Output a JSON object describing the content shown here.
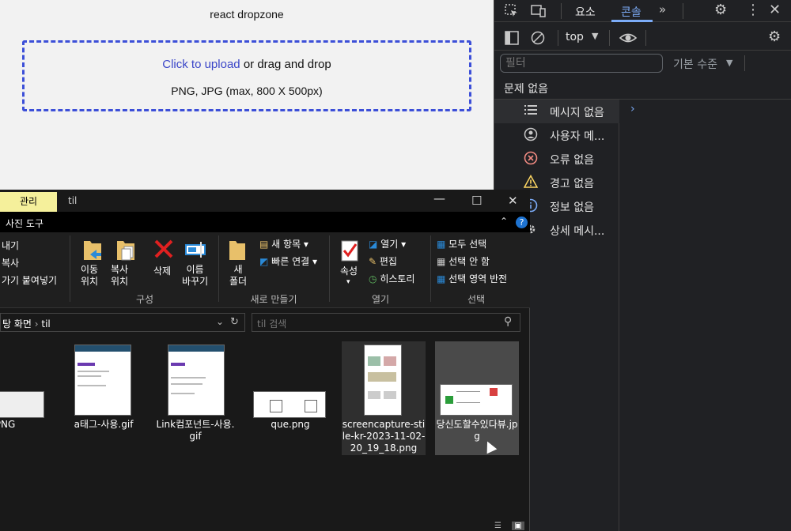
{
  "browser": {
    "heading": "react dropzone",
    "dropzone": {
      "link_text": "Click to upload",
      "rest_text": "or drag and drop",
      "hint": "PNG, JPG (max, 800 X 500px)"
    }
  },
  "devtools": {
    "tabs": {
      "elements": "요소",
      "console": "콘솔"
    },
    "context": "top",
    "filter_placeholder": "필터",
    "level": "기본 수준",
    "issues": "문제 없음",
    "sidebar": [
      {
        "icon": "list-icon",
        "label": "메시지 없음"
      },
      {
        "icon": "user-icon",
        "label": "사용자 메..."
      },
      {
        "icon": "error-icon",
        "label": "오류 없음"
      },
      {
        "icon": "warning-icon",
        "label": "경고 없음"
      },
      {
        "icon": "info-icon",
        "label": "정보 없음"
      },
      {
        "icon": "verbose-icon",
        "label": "상세 메시..."
      }
    ],
    "colors": {
      "accent": "#7cacf8",
      "background": "#202124"
    }
  },
  "explorer": {
    "manage_tab": "관리",
    "title": "til",
    "picture_tools": "사진 도구",
    "clipboard": {
      "paste_partial": "내기",
      "copy": "복사",
      "paste_shortcut": "가기 붙여넣기"
    },
    "organize": {
      "move": "이동\n위치",
      "copy_to": "복사\n위치",
      "delete": "삭제",
      "rename": "이름\n바꾸기",
      "group": "구성"
    },
    "new": {
      "folder": "새\n폴더",
      "new_item": "새 항목",
      "easy_access": "빠른 연결",
      "group": "새로 만들기"
    },
    "open": {
      "properties": "속성",
      "open": "열기",
      "edit": "편집",
      "history": "히스토리",
      "group": "열기"
    },
    "select": {
      "select_all": "모두 선택",
      "select_none": "선택 안 함",
      "invert": "선택 영역 반전",
      "group": "선택"
    },
    "address": {
      "parent": "탕 화면",
      "current": "til"
    },
    "search_placeholder": "til 검색",
    "files": [
      {
        "name": "l.PNG"
      },
      {
        "name": "a태그-사용.gif"
      },
      {
        "name": "Link컴포넌트-사용.gif"
      },
      {
        "name": "que.png"
      },
      {
        "name": "screencapture-stile-kr-2023-11-02-20_19_18.png"
      },
      {
        "name": "당신도할수있다뷰.jpg"
      }
    ]
  }
}
